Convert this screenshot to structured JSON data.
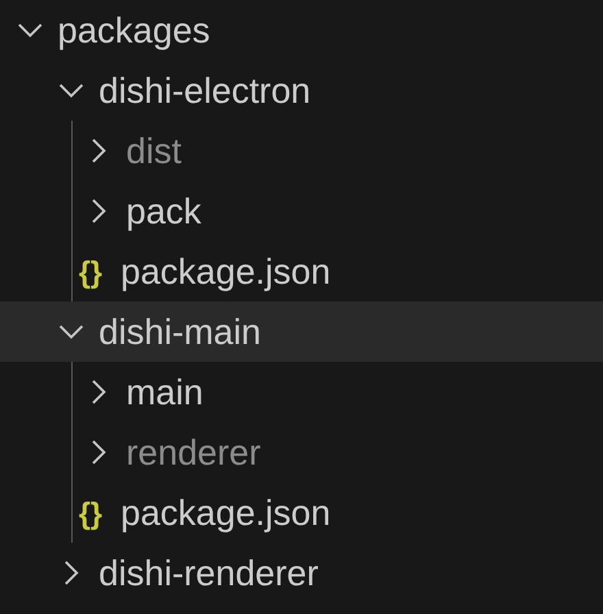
{
  "tree": [
    {
      "label": "packages",
      "kind": "folder",
      "expanded": true,
      "selected": false,
      "dimmed": false,
      "children": [
        {
          "label": "dishi-electron",
          "kind": "folder",
          "expanded": true,
          "selected": false,
          "dimmed": false,
          "children": [
            {
              "label": "dist",
              "kind": "folder",
              "expanded": false,
              "selected": false,
              "dimmed": true
            },
            {
              "label": "pack",
              "kind": "folder",
              "expanded": false,
              "selected": false,
              "dimmed": false
            },
            {
              "label": "package.json",
              "kind": "file",
              "icon_text": "{}",
              "selected": false,
              "dimmed": false
            }
          ]
        },
        {
          "label": "dishi-main",
          "kind": "folder",
          "expanded": true,
          "selected": true,
          "dimmed": false,
          "children": [
            {
              "label": "main",
              "kind": "folder",
              "expanded": false,
              "selected": false,
              "dimmed": false
            },
            {
              "label": "renderer",
              "kind": "folder",
              "expanded": false,
              "selected": false,
              "dimmed": true
            },
            {
              "label": "package.json",
              "kind": "file",
              "icon_text": "{}",
              "selected": false,
              "dimmed": false
            }
          ]
        },
        {
          "label": "dishi-renderer",
          "kind": "folder",
          "expanded": false,
          "selected": false,
          "dimmed": false
        }
      ]
    }
  ]
}
